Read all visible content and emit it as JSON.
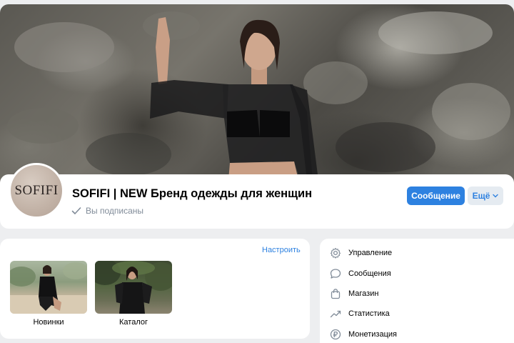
{
  "cover": {
    "alt_icon": "cover-photo"
  },
  "profile": {
    "avatar_text": "SOFIFI",
    "title": "SOFIFI | NEW Бренд одежды для женщин",
    "subscribed_label": "Вы подписаны",
    "message_button": "Сообщение",
    "more_button": "Ещё"
  },
  "showcase": {
    "configure_label": "Настроить",
    "items": [
      {
        "label": "Новинки"
      },
      {
        "label": "Каталог"
      }
    ]
  },
  "admin_menu": {
    "items": [
      {
        "label": "Управление",
        "icon": "gear-icon"
      },
      {
        "label": "Сообщения",
        "icon": "chat-icon"
      },
      {
        "label": "Магазин",
        "icon": "shopping-bag-icon"
      },
      {
        "label": "Статистика",
        "icon": "chart-icon"
      },
      {
        "label": "Монетизация",
        "icon": "ruble-icon"
      }
    ]
  },
  "colors": {
    "accent": "#2d81e0",
    "muted_text": "#818c99",
    "background": "#edeef0"
  }
}
